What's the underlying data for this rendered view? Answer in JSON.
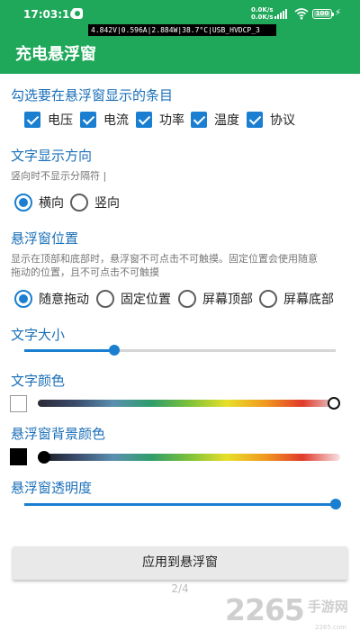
{
  "status_bar": {
    "time": "17:03:16",
    "net_up": "0.0K/s",
    "net_down": "0.0K/s",
    "battery": "100",
    "icons": [
      "app-icon",
      "signal-icon",
      "wifi-icon",
      "battery-icon",
      "charging-icon"
    ]
  },
  "app_bar": {
    "title": "充电悬浮窗"
  },
  "overlay_readout": "4.842V|0.596A|2.884W|38.7°C|USB_HVDCP_3",
  "items_section": {
    "title": "勾选要在悬浮窗显示的条目",
    "checkboxes": [
      {
        "label": "电压",
        "checked": true
      },
      {
        "label": "电流",
        "checked": true
      },
      {
        "label": "功率",
        "checked": true
      },
      {
        "label": "温度",
        "checked": true
      },
      {
        "label": "协议",
        "checked": true
      }
    ]
  },
  "direction_section": {
    "title": "文字显示方向",
    "hint": "竖向时不显示分隔符 |",
    "options": [
      "横向",
      "竖向"
    ],
    "selected": "横向"
  },
  "position_section": {
    "title": "悬浮窗位置",
    "hint_line1": "显示在顶部和底部时，悬浮窗不可点击不可触摸。固定位置会使用随意",
    "hint_line2": "拖动的位置，且不可点击不可触摸",
    "options": [
      "随意拖动",
      "固定位置",
      "屏幕顶部",
      "屏幕底部"
    ],
    "selected": "随意拖动"
  },
  "text_size_section": {
    "title": "文字大小",
    "value_fraction": 0.29
  },
  "text_color_section": {
    "title": "文字颜色",
    "value_fraction": 1.0,
    "swatch_color": "#ffffff"
  },
  "bg_color_section": {
    "title": "悬浮窗背景颜色",
    "value_fraction": 0.0,
    "swatch_color": "#000000"
  },
  "opacity_section": {
    "title": "悬浮窗透明度",
    "value_fraction": 1.0
  },
  "apply_button": "应用到悬浮窗",
  "page_indicator": "2/4",
  "watermark": {
    "number": "2265",
    "text": "手游网",
    "sub": "2265.com"
  },
  "colors": {
    "accent": "#1a7fd1",
    "bar": "#1fa85a",
    "section_title": "#1a6fb8"
  }
}
